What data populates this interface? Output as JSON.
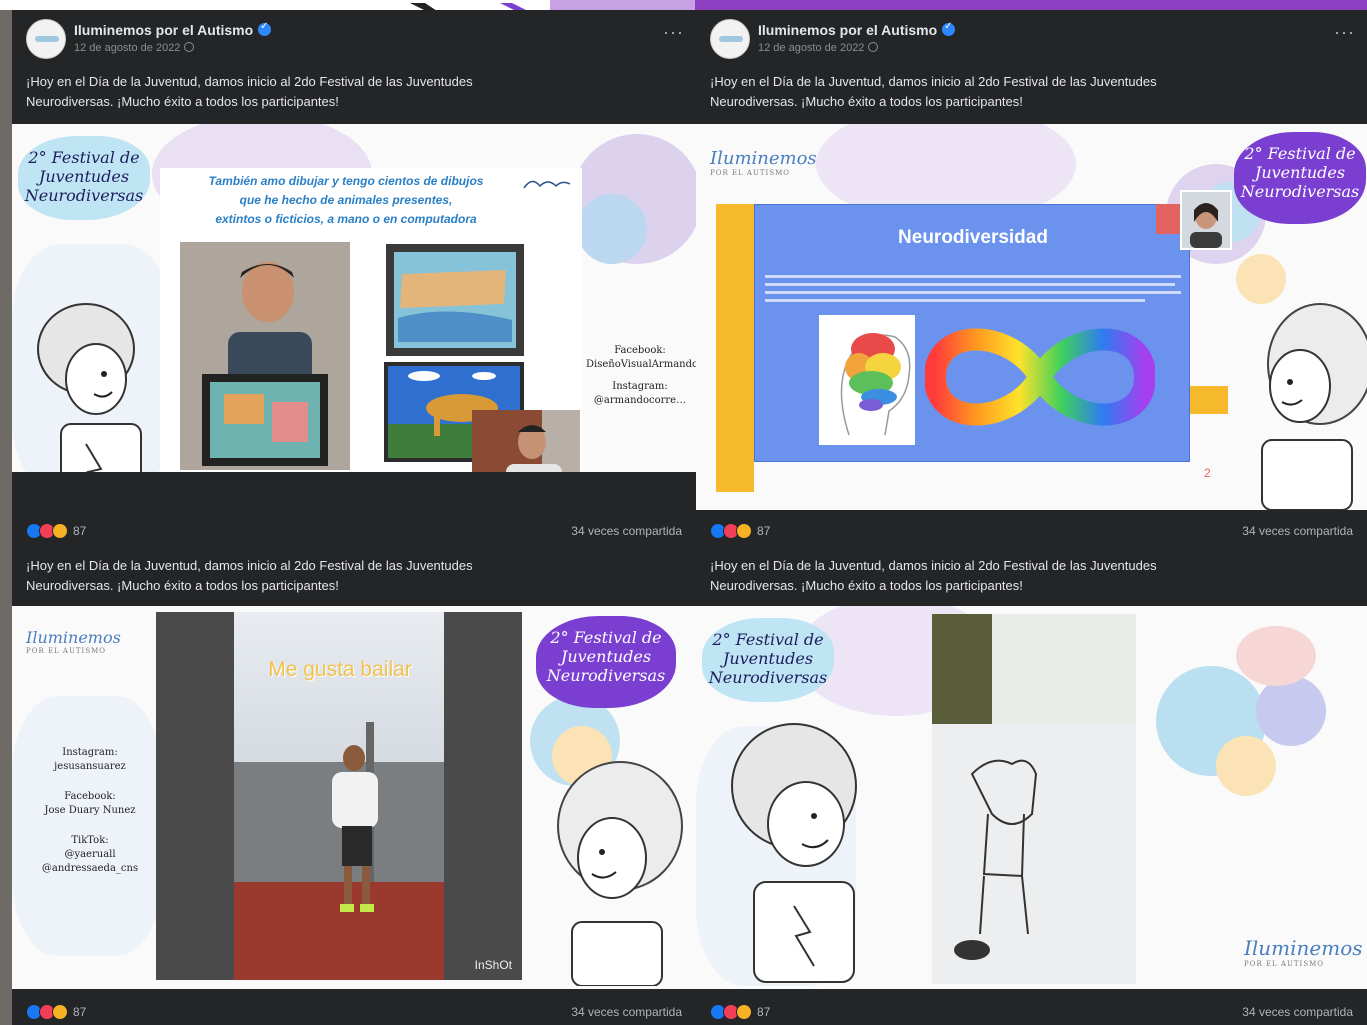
{
  "posts": [
    {
      "page_name": "Iluminemos por el Autismo",
      "date": "12 de agosto de 2022",
      "caption_line1": "¡Hoy en el Día de la Juventud, damos inicio al 2do Festival de las Juventudes",
      "caption_line2": "Neurodiversas. ¡Mucho éxito a todos los participantes!",
      "reaction_count": "87",
      "shares": "34 veces compartida",
      "slide": {
        "title_line1": "También amo dibujar y tengo cientos de dibujos",
        "title_line2": "que he hecho de animales presentes,",
        "title_line3": "extintos o ficticios, a mano o en computadora",
        "social_line1": "Facebook:",
        "social_line2": "DiseñoVisualArmandoAlguacil",
        "social_line3": "Instagram:",
        "social_line4": "@armandocorre…"
      }
    },
    {
      "page_name": "Iluminemos por el Autismo",
      "date": "12 de agosto de 2022",
      "caption_line1": "¡Hoy en el Día de la Juventud, damos inicio al 2do Festival de las Juventudes",
      "caption_line2": "Neurodiversas. ¡Mucho éxito a todos los participantes!",
      "reaction_count": "87",
      "shares": "34 veces compartida",
      "slide": {
        "title": "Neurodiversidad",
        "page_number": "2"
      }
    },
    {
      "caption_line1": "¡Hoy en el Día de la Juventud, damos inicio al 2do Festival de las Juventudes",
      "caption_line2": "Neurodiversas. ¡Mucho éxito a todos los participantes!",
      "reaction_count": "87",
      "shares": "34 veces compartida",
      "slide": {
        "video_text": "Me gusta bailar",
        "watermark": "InShOt",
        "social_line1": "Instagram:",
        "social_line2": "jesusansuarez",
        "social_line3": "Facebook:",
        "social_line4": "Jose Duary Nunez",
        "social_line5": "TikTok:",
        "social_line6": "@yaeruall",
        "social_line7": "@andressaeda_cns"
      }
    },
    {
      "caption_line1": "¡Hoy en el Día de la Juventud, damos inicio al 2do Festival de las Juventudes",
      "caption_line2": "Neurodiversas. ¡Mucho éxito a todos los participantes!",
      "reaction_count": "87",
      "shares": "34 veces compartida"
    }
  ],
  "festival_logo": {
    "line1": "2° Festival de",
    "line2": "Juventudes",
    "line3": "Neurodiversas"
  },
  "brand_logo": {
    "name": "Iluminemos",
    "sub": "POR EL AUTISMO"
  },
  "icons": {
    "verified": "verified-badge-icon",
    "globe": "globe-icon",
    "more": "more-options-icon",
    "reactions": [
      "like-icon",
      "love-icon",
      "haha-icon"
    ]
  },
  "colors": {
    "post_bg": "#242526",
    "text": "#e4e6eb",
    "secondary_text": "#b0b3b8",
    "festival_purple": "#7a3fd1",
    "slide_blue": "#6b93ee",
    "accent_yellow": "#f6b92b"
  }
}
